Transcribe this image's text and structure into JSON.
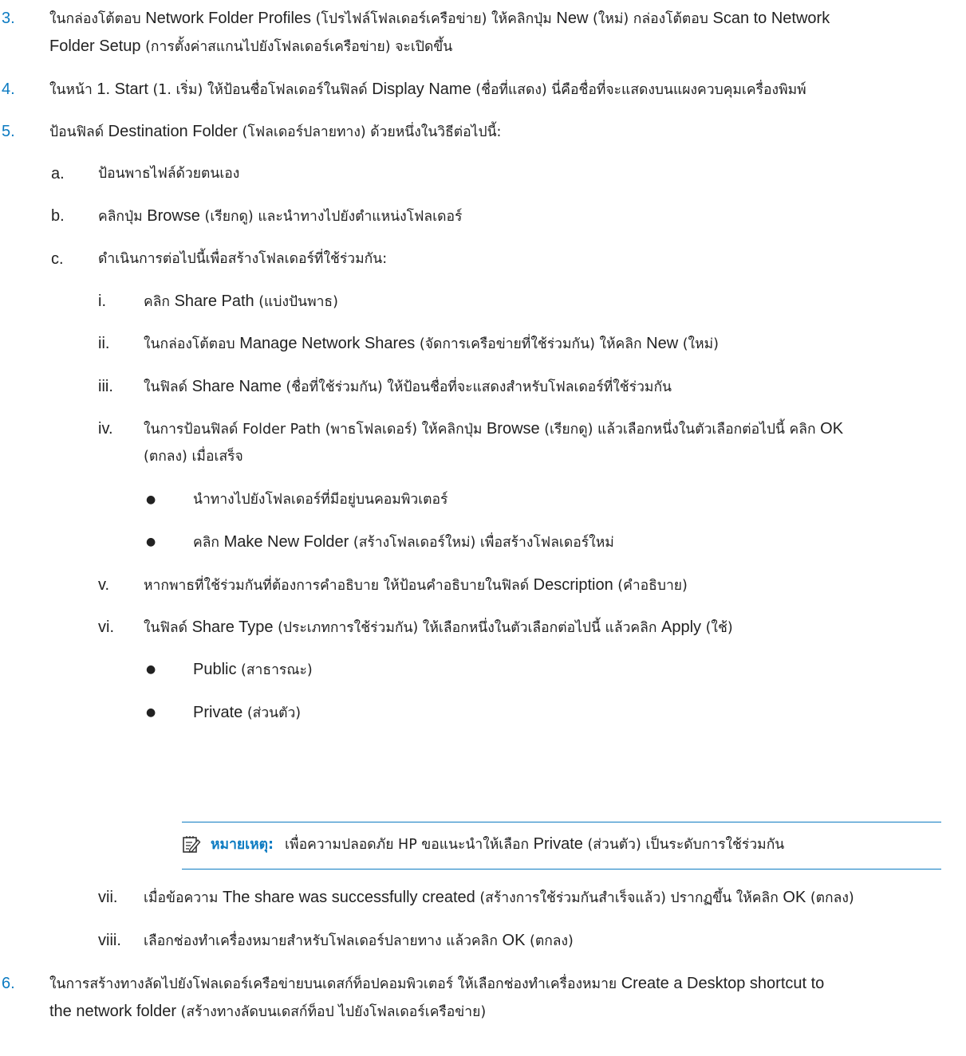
{
  "steps": [
    {
      "num": "3.",
      "l1_pre": "ในกล่องโต้ตอบ ",
      "l1_b1": "Network Folder Profiles",
      "l1_mid1": " (โปรไฟล์โฟลเดอร์เครือข่าย) ให้คลิกปุ่ม ",
      "l1_b2": "New",
      "l1_mid2": " (ใหม่) กล่องโต้ตอบ ",
      "l1_b3": "Scan to Network",
      "l2_b1": "Folder Setup",
      "l2_post": " (การตั้งค่าสแกนไปยังโฟลเดอร์เครือข่าย) จะเปิดขึ้น"
    },
    {
      "num": "4.",
      "pre": "ในหน้า ",
      "b1": "1. Start",
      "mid1": " (1. เริ่ม) ให้ป้อนชื่อโฟลเดอร์ในฟิลด์ ",
      "b2": "Display Name",
      "post": " (ชื่อที่แสดง) นี่คือชื่อที่จะแสดงบนแผงควบคุมเครื่องพิมพ์"
    },
    {
      "num": "5.",
      "pre": "ป้อนฟิลด์ ",
      "b1": "Destination Folder",
      "post": " (โฟลเดอร์ปลายทาง) ด้วยหนึ่งในวิธีต่อไปนี้:"
    },
    {
      "num": "6.",
      "l1_pre": "ในการสร้างทางลัดไปยังโฟลเดอร์เครือข่ายบนเดสก์ท็อปคอมพิวเตอร์ ให้เลือกช่องทำเครื่องหมาย ",
      "l1_b1": "Create a Desktop shortcut to",
      "l2_b1": "the network folder",
      "l2_post": " (สร้างทางลัดบนเดสก์ท็อป ไปยังโฟลเดอร์เครือข่าย)"
    }
  ],
  "substeps": {
    "a": {
      "num": "a.",
      "text": "ป้อนพาธไฟล์ด้วยตนเอง"
    },
    "b": {
      "num": "b.",
      "pre": "คลิกปุ่ม ",
      "b1": "Browse",
      "post": " (เรียกดู) และนำทางไปยังตำแหน่งโฟลเดอร์"
    },
    "c": {
      "num": "c.",
      "text": "ดำเนินการต่อไปนี้เพื่อสร้างโฟลเดอร์ที่ใช้ร่วมกัน:"
    }
  },
  "roman": {
    "i": {
      "num": "i.",
      "pre": "คลิก ",
      "b1": "Share Path",
      "post": " (แบ่งปันพาธ)"
    },
    "ii": {
      "num": "ii.",
      "pre": "ในกล่องโต้ตอบ ",
      "b1": "Manage Network Shares",
      "mid1": " (จัดการเครือข่ายที่ใช้ร่วมกัน) ให้คลิก ",
      "b2": "New",
      "post": " (ใหม่)"
    },
    "iii": {
      "num": "iii.",
      "pre": "ในฟิลด์ ",
      "b1": "Share Name",
      "post": " (ชื่อที่ใช้ร่วมกัน) ให้ป้อนชื่อที่จะแสดงสำหรับโฟลเดอร์ที่ใช้ร่วมกัน"
    },
    "iv": {
      "num": "iv.",
      "l1_pre": "ในการป้อนฟิลด์ Folder Path (พาธโฟลเดอร์) ให้คลิกปุ่ม ",
      "l1_b1": "Browse",
      "l1_mid1": " (เรียกดู) แล้วเลือกหนึ่งในตัวเลือกต่อไปนี้ คลิก ",
      "l1_b2": "OK",
      "l2_text": "(ตกลง) เมื่อเสร็จ"
    },
    "v": {
      "num": "v.",
      "pre": "หากพาธที่ใช้ร่วมกันที่ต้องการคำอธิบาย ให้ป้อนคำอธิบายในฟิลด์ ",
      "b1": "Description",
      "post": " (คำอธิบาย)"
    },
    "vi": {
      "num": "vi.",
      "pre": "ในฟิลด์ ",
      "b1": "Share Type",
      "mid1": " (ประเภทการใช้ร่วมกัน) ให้เลือกหนึ่งในตัวเลือกต่อไปนี้ แล้วคลิก ",
      "b2": "Apply",
      "post": " (ใช้)"
    },
    "vii": {
      "num": "vii.",
      "pre": "เมื่อข้อความ ",
      "b1": "The share was successfully created",
      "mid1": " (สร้างการใช้ร่วมกันสำเร็จแล้ว) ปรากฏขึ้น ให้คลิก ",
      "b2": "OK",
      "post": " (ตกลง)"
    },
    "viii": {
      "num": "viii.",
      "pre": "เลือกช่องทำเครื่องหมายสำหรับโฟลเดอร์ปลายทาง แล้วคลิก ",
      "b1": "OK",
      "post": " (ตกลง)"
    }
  },
  "bullets": {
    "iv_1": {
      "symbol": "●",
      "text": "นำทางไปยังโฟลเดอร์ที่มีอยู่บนคอมพิวเตอร์"
    },
    "iv_2": {
      "symbol": "●",
      "pre": "คลิก ",
      "b1": "Make New Folder",
      "post": " (สร้างโฟลเดอร์ใหม่) เพื่อสร้างโฟลเดอร์ใหม่"
    },
    "vi_1": {
      "symbol": "●",
      "b1": "Public",
      "post": " (สาธารณะ)"
    },
    "vi_2": {
      "symbol": "●",
      "b1": "Private",
      "post": " (ส่วนตัว)"
    }
  },
  "note": {
    "icon": "note-pencil-icon",
    "label": "หมายเหตุ:",
    "pre": "เพื่อความปลอดภัย HP ขอแนะนำให้เลือก ",
    "b1": "Private",
    "post": " (ส่วนตัว) เป็นระดับการใช้ร่วมกัน"
  },
  "colors": {
    "accent": "#0c7bc2",
    "text": "#222222"
  }
}
